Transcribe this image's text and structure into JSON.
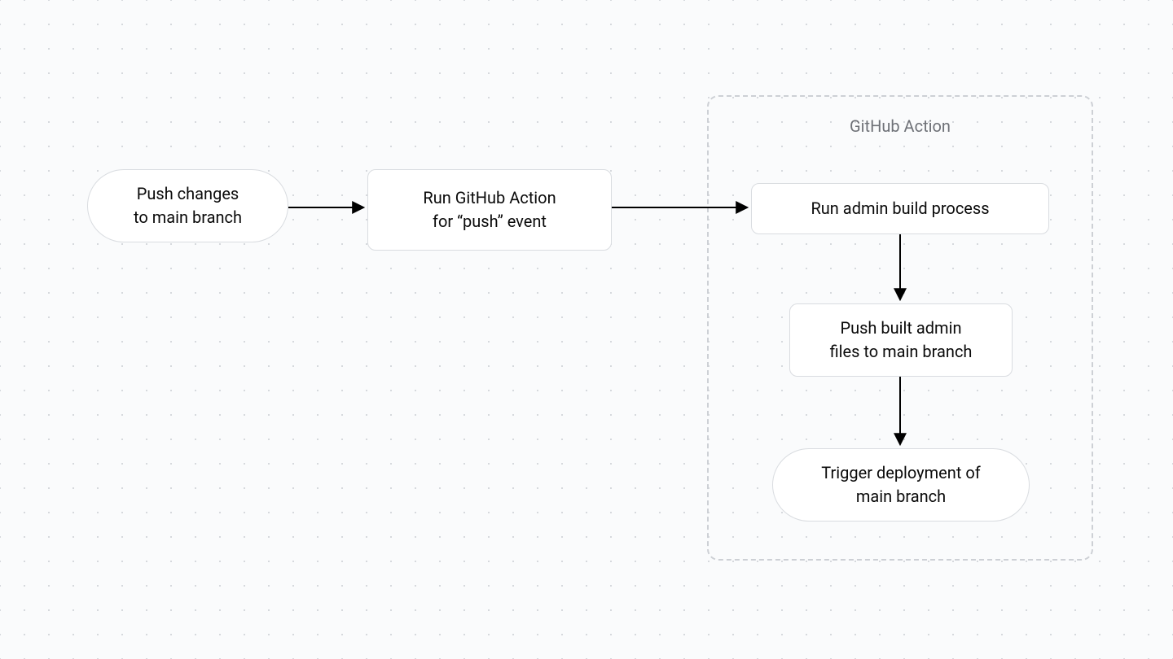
{
  "group": {
    "label": "GitHub Action"
  },
  "nodes": {
    "push_changes": {
      "line1": "Push changes",
      "line2": "to main branch"
    },
    "run_action": {
      "line1": "Run GitHub Action",
      "line2": "for “push” event"
    },
    "build": {
      "line1": "Run admin build process"
    },
    "push_built": {
      "line1": "Push built admin",
      "line2": "files to main branch"
    },
    "deploy": {
      "line1": "Trigger deployment of",
      "line2": "main branch"
    }
  },
  "chart_data": {
    "type": "flowchart",
    "group": {
      "label": "GitHub Action",
      "contains": [
        "build",
        "push_built",
        "deploy"
      ]
    },
    "nodes": [
      {
        "id": "push_changes",
        "label": "Push changes to main branch",
        "shape": "pill"
      },
      {
        "id": "run_action",
        "label": "Run GitHub Action for “push” event",
        "shape": "box"
      },
      {
        "id": "build",
        "label": "Run admin build process",
        "shape": "box"
      },
      {
        "id": "push_built",
        "label": "Push built admin files to main branch",
        "shape": "box"
      },
      {
        "id": "deploy",
        "label": "Trigger deployment of main branch",
        "shape": "pill"
      }
    ],
    "edges": [
      {
        "from": "push_changes",
        "to": "run_action"
      },
      {
        "from": "run_action",
        "to": "build"
      },
      {
        "from": "build",
        "to": "push_built"
      },
      {
        "from": "push_built",
        "to": "deploy"
      }
    ]
  }
}
